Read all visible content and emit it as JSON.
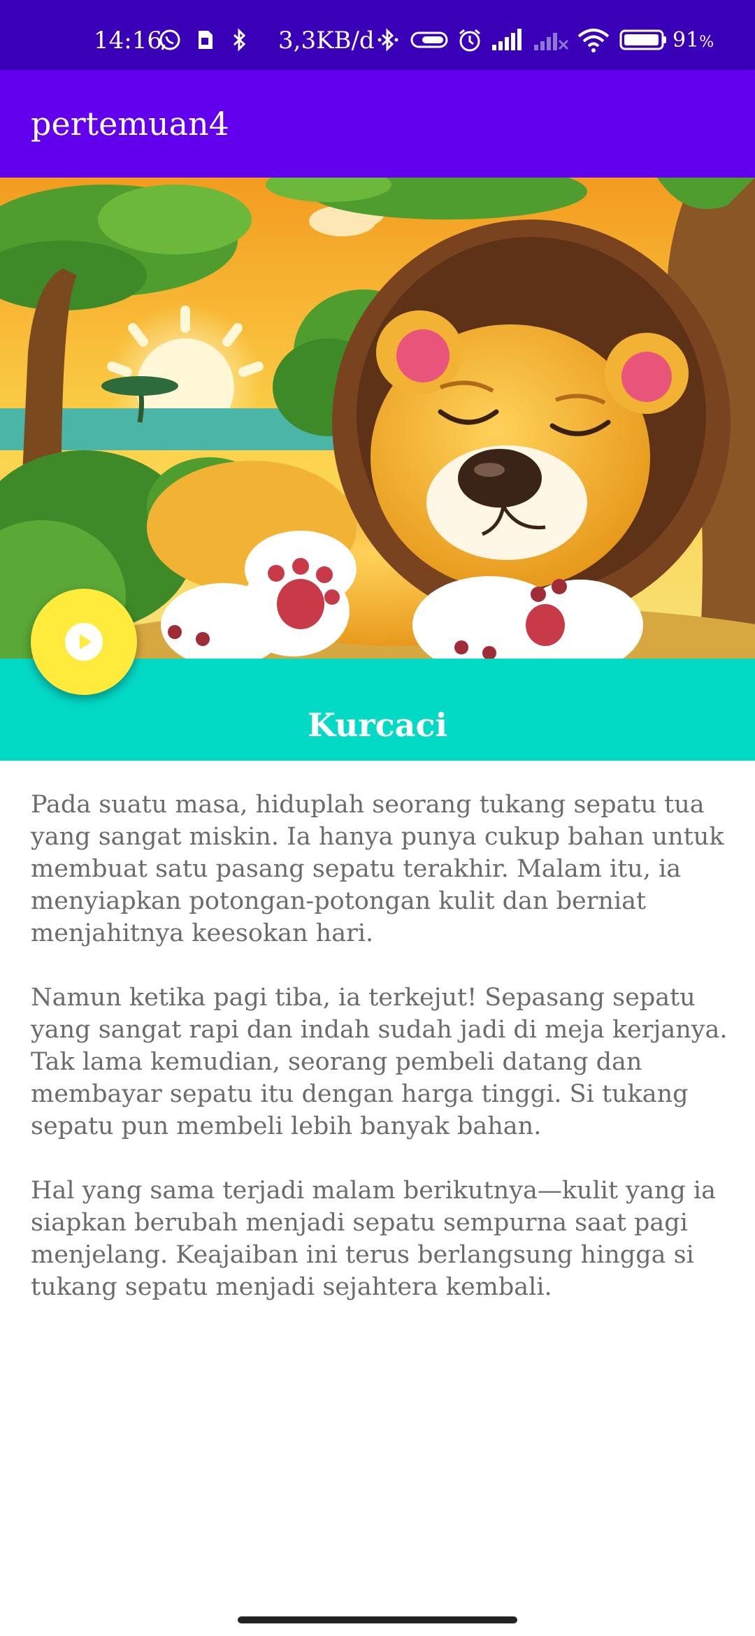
{
  "status_bar": {
    "time": "14:16",
    "network_speed": "3,3KB/d",
    "battery_percent": "91",
    "battery_unit": "%",
    "icons": [
      "whatsapp-icon",
      "sim-icon",
      "bluetooth-icon",
      "bluetooth-icon",
      "link-icon",
      "alarm-icon",
      "signal-icon",
      "signal-off-icon",
      "wifi-icon",
      "battery-icon"
    ]
  },
  "app_bar": {
    "title": "pertemuan4"
  },
  "hero": {
    "image": "sleeping-lion-illustration"
  },
  "fab": {
    "icon": "play-icon",
    "color": "#ffeb3b"
  },
  "story": {
    "title": "Kurcaci",
    "paragraphs": [
      "Pada suatu masa, hiduplah seorang tukang sepatu tua yang sangat miskin. Ia hanya punya cukup bahan untuk membuat satu pasang sepatu terakhir. Malam itu, ia menyiapkan potongan-potongan kulit dan berniat menjahitnya keesokan hari.",
      "Namun ketika pagi tiba, ia terkejut! Sepasang sepatu yang sangat rapi dan indah sudah jadi di meja kerjanya. Tak lama kemudian, seorang pembeli datang dan membayar sepatu itu dengan harga tinggi. Si tukang sepatu pun membeli lebih banyak bahan.",
      "Hal yang sama terjadi malam berikutnya—kulit yang ia siapkan berubah menjadi sepatu sempurna saat pagi menjelang. Keajaiban ini terus berlangsung hingga si tukang sepatu menjadi sejahtera kembali."
    ]
  },
  "colors": {
    "status_bar": "#3a00b8",
    "app_bar": "#6200ee",
    "title_band": "#03dac6",
    "text": "#6b6b6b"
  }
}
